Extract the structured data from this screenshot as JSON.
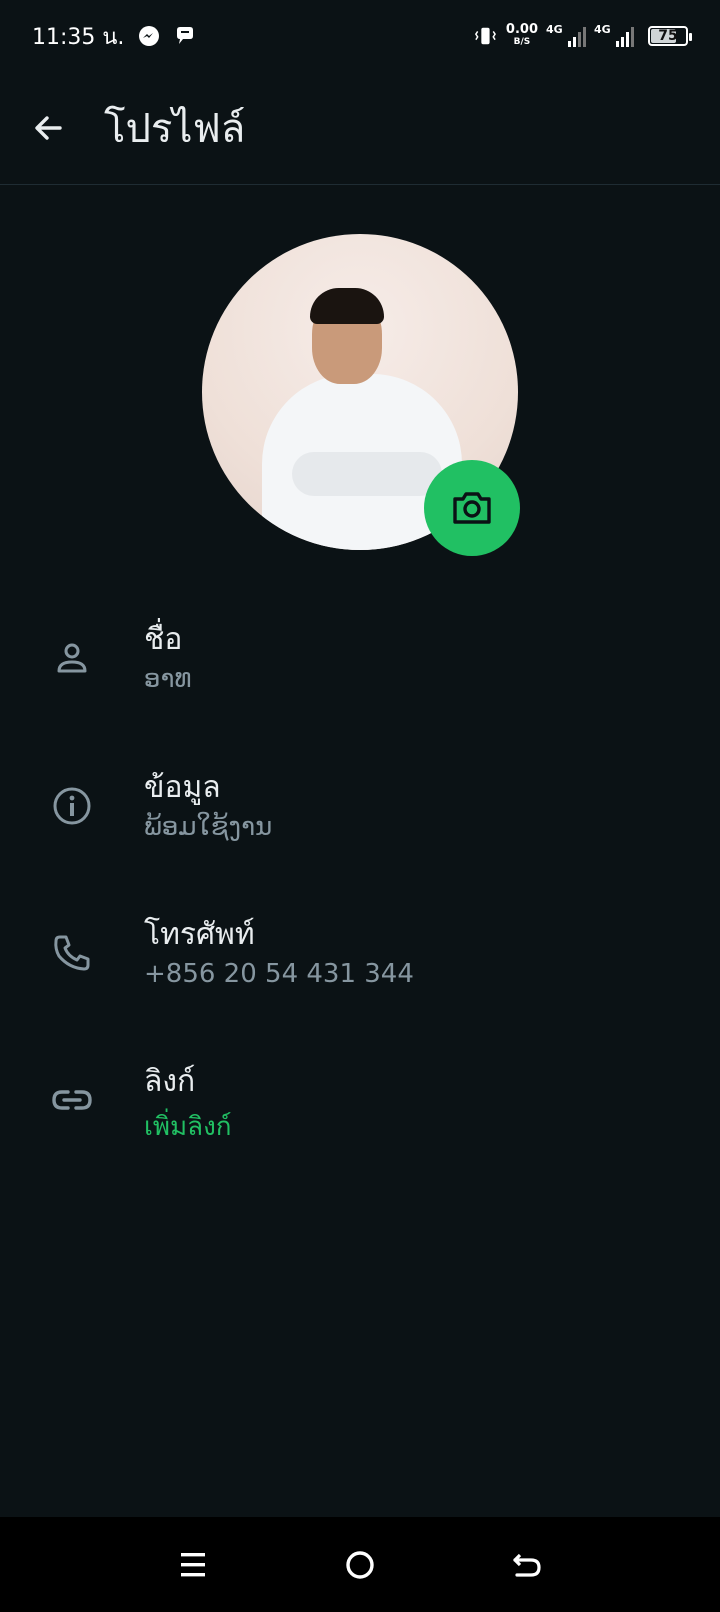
{
  "status_bar": {
    "time": "11:35 น.",
    "net_speed": "0.00",
    "net_unit": "B/S",
    "signal1_label": "4G",
    "signal2_label": "4G",
    "battery": "75",
    "battery_level_percent": 75
  },
  "app_bar": {
    "title": "โปรไฟล์"
  },
  "profile": {
    "rows": [
      {
        "label": "ชื่อ",
        "value": "ອາທ",
        "icon": "person-icon"
      },
      {
        "label": "ข้อมูล",
        "value": "ພ້ອມໃຊ້ງານ",
        "icon": "info-icon"
      },
      {
        "label": "โทรศัพท์",
        "value": "+856 20 54 431 344",
        "icon": "phone-icon"
      },
      {
        "label": "ลิงก์",
        "value": "เพิ่มลิงก์",
        "icon": "link-icon"
      }
    ]
  },
  "colors": {
    "background": "#0b1215",
    "accent": "#21c063",
    "secondary_text": "#8696a0"
  }
}
